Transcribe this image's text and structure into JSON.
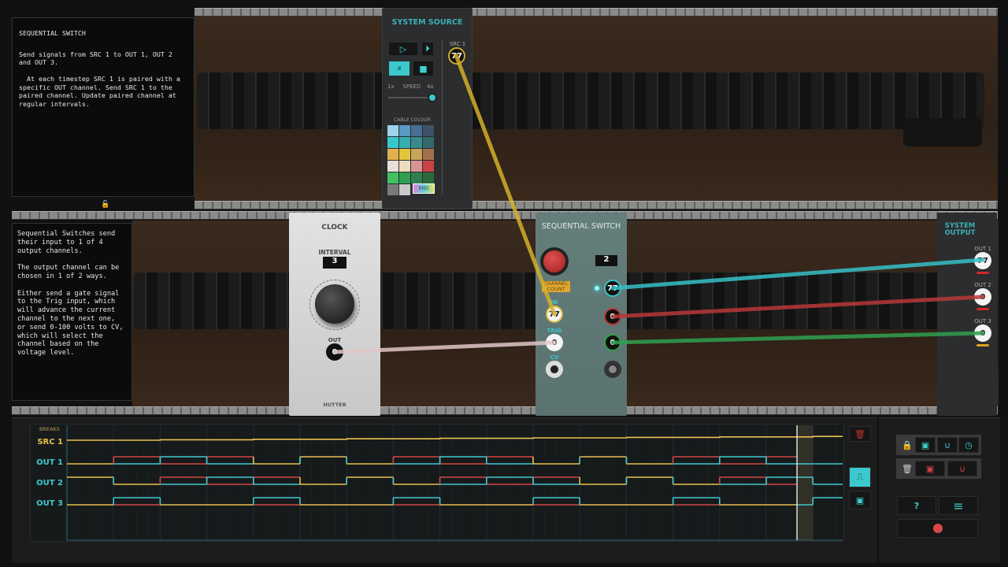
{
  "top_info": {
    "title": "SEQUENTIAL SWITCH",
    "body": "Send signals from SRC 1 to OUT 1, OUT 2 and OUT 3.\n\n  At each timestep SRC 1 is paired with a specific OUT channel. Send SRC 1 to the paired channel. Update paired channel at regular intervals."
  },
  "mid_info": {
    "body": "Sequential Switches send their input to 1 of 4 output channels.\n\nThe output channel can be chosen in 1 of 2 ways.\n\nEither send a gate signal to the Trig input, which will advance the current channel to the next one, or send 0-100 volts to CV, which will select the channel based on the voltage level."
  },
  "system_source": {
    "title": "SYSTEM SOURCE",
    "src_label": "SRC 1",
    "src_value": "77",
    "speed_label": "SPEED",
    "speed_min": "1x",
    "speed_max": "4x",
    "speed_level": 1.0,
    "cable_colour_label": "CABLE COLOUR",
    "rnd_label": "RND",
    "swatches": [
      "#9fd4ea",
      "#5a9ac4",
      "#4a6f95",
      "#3c5268",
      "#35c9cc",
      "#36aeb0",
      "#3a8a8c",
      "#346a6c",
      "#e4b04c",
      "#e2c53a",
      "#c9a45a",
      "#a5714c",
      "#e8e0d8",
      "#ecdcc0",
      "#d89494",
      "#c84444",
      "#40c060",
      "#30a050",
      "#2e8050",
      "#2a6a3a",
      "#7a7a7a",
      "#c8c8c8"
    ]
  },
  "clock": {
    "title": "CLOCK",
    "interval_label": "INTERVAL",
    "interval_value": "3",
    "out_label": "OUT",
    "out_value": "0",
    "brand": "HUTTER"
  },
  "seq_switch": {
    "title": "SEQUENTIAL SWITCH",
    "channel_count_label": "CHANNEL COUNT",
    "channel_count": "2",
    "in_label": "IN",
    "in_value": "77",
    "trig_label": "TRIG",
    "trig_value": "0",
    "cv_label": "CV",
    "outputs": [
      "77",
      "0",
      "0"
    ]
  },
  "system_output": {
    "title": "SYSTEM OUTPUT",
    "outputs": [
      {
        "label": "OUT 1",
        "value": "77",
        "indicator": "#d02828"
      },
      {
        "label": "OUT 2",
        "value": "0",
        "indicator": "#d02828"
      },
      {
        "label": "OUT 3",
        "value": "0",
        "indicator": "#e0a020"
      }
    ]
  },
  "cables": {
    "src_to_in": "#d4b02a",
    "clock_to_trig": "#e0c8c8",
    "out1": "#35c0c8",
    "out2": "#b83838",
    "out3": "#30a050"
  },
  "timeline": {
    "breaks_label": "BREAKS",
    "playhead_step": 15.66,
    "src1": {
      "label": "SRC 1",
      "levels": [
        0,
        0,
        0.1,
        0.1,
        0.2,
        0.2,
        0.3,
        0.3,
        0.4,
        0.4,
        0.5,
        0.5,
        0.6,
        0.6,
        0.7,
        0.7,
        0.8
      ]
    },
    "channels": [
      {
        "label": "OUT 1",
        "expected": [
          0,
          1,
          0,
          1,
          0,
          1,
          0,
          1,
          0,
          1,
          0,
          1,
          0,
          1,
          0,
          1
        ],
        "actual": [
          0,
          0,
          1,
          0,
          0,
          1,
          0,
          0,
          1,
          0,
          0,
          1,
          0,
          0,
          1,
          0,
          0
        ]
      },
      {
        "label": "OUT 2",
        "expected": [
          1,
          0,
          1,
          0,
          1,
          0,
          1,
          0,
          1,
          0,
          1,
          0,
          1,
          0,
          1,
          0
        ],
        "actual": [
          1,
          0,
          0,
          1,
          0,
          0,
          1,
          0,
          0,
          1,
          0,
          0,
          1,
          0,
          0,
          1,
          0
        ]
      },
      {
        "label": "OUT 3",
        "expected": [
          0,
          0,
          0,
          0,
          0,
          0,
          0,
          0,
          0,
          0,
          0,
          0,
          0,
          0,
          0,
          0
        ],
        "actual": [
          0,
          1,
          0,
          0,
          1,
          0,
          0,
          1,
          0,
          0,
          1,
          0,
          0,
          1,
          0,
          0,
          1
        ]
      }
    ],
    "colors": {
      "match": "#e8c050",
      "expected": "#d04848",
      "actual": "#40c8d0"
    }
  },
  "controls": {
    "play": "▷",
    "step": "⏵",
    "pause": "⏸",
    "stop": "■",
    "help": "?",
    "menu": "≡"
  }
}
